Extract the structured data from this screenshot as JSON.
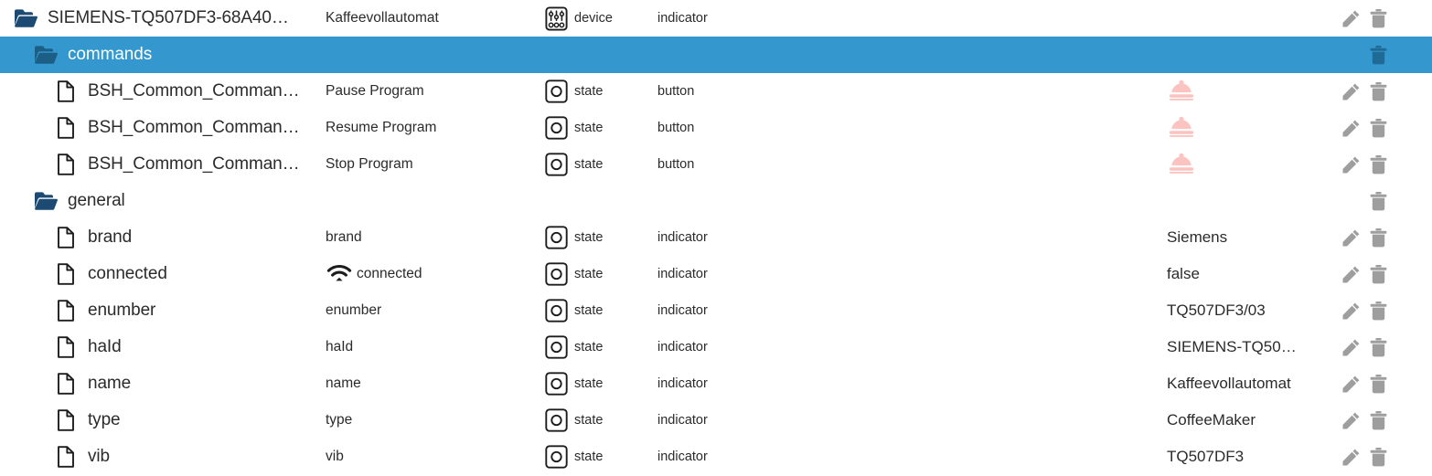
{
  "theme": {
    "selected_row_bg": "#3498cf",
    "folder_icon_color": "#1c4a73",
    "file_icon_color": "#1d1d1d",
    "action_icon_color": "#9e9e9e",
    "selected_action_icon_color": "#1f6b96",
    "alarm_icon_color": "#fbc4c0",
    "text_color": "#2b2b2b"
  },
  "icons": {
    "folder": "folder-icon",
    "file": "file-icon",
    "device": "device-sliders-icon",
    "state": "state-circle-icon",
    "wifi": "wifi-icon",
    "alarm": "bell-dome-icon",
    "edit": "pencil-icon",
    "delete": "trash-icon"
  },
  "rows": [
    {
      "id": "SIEMENS-TQ507DF3-68A40…",
      "common_name": "Kaffeevollautomat",
      "role_icon": "device",
      "role": "device",
      "kind": "indicator",
      "value": "",
      "type": "folder",
      "depth": 0,
      "selected": false,
      "wifi": false,
      "alarm": false,
      "edit": true,
      "delete": true
    },
    {
      "id": "commands",
      "common_name": "",
      "role_icon": "",
      "role": "",
      "kind": "",
      "value": "",
      "type": "folder",
      "depth": 1,
      "selected": true,
      "wifi": false,
      "alarm": false,
      "edit": false,
      "delete": true
    },
    {
      "id": "BSH_Common_Comman…",
      "common_name": "Pause Program",
      "role_icon": "state",
      "role": "state",
      "kind": "button",
      "value": "",
      "type": "file",
      "depth": 2,
      "selected": false,
      "wifi": false,
      "alarm": true,
      "edit": true,
      "delete": true
    },
    {
      "id": "BSH_Common_Comman…",
      "common_name": "Resume Program",
      "role_icon": "state",
      "role": "state",
      "kind": "button",
      "value": "",
      "type": "file",
      "depth": 2,
      "selected": false,
      "wifi": false,
      "alarm": true,
      "edit": true,
      "delete": true
    },
    {
      "id": "BSH_Common_Comman…",
      "common_name": "Stop Program",
      "role_icon": "state",
      "role": "state",
      "kind": "button",
      "value": "",
      "type": "file",
      "depth": 2,
      "selected": false,
      "wifi": false,
      "alarm": true,
      "edit": true,
      "delete": true
    },
    {
      "id": "general",
      "common_name": "",
      "role_icon": "",
      "role": "",
      "kind": "",
      "value": "",
      "type": "folder",
      "depth": 1,
      "selected": false,
      "wifi": false,
      "alarm": false,
      "edit": false,
      "delete": true
    },
    {
      "id": "brand",
      "common_name": "brand",
      "role_icon": "state",
      "role": "state",
      "kind": "indicator",
      "value": "Siemens",
      "type": "file",
      "depth": 2,
      "selected": false,
      "wifi": false,
      "alarm": false,
      "edit": true,
      "delete": true
    },
    {
      "id": "connected",
      "common_name": "connected",
      "role_icon": "state",
      "role": "state",
      "kind": "indicator",
      "value": "false",
      "type": "file",
      "depth": 2,
      "selected": false,
      "wifi": true,
      "alarm": false,
      "edit": true,
      "delete": true
    },
    {
      "id": "enumber",
      "common_name": "enumber",
      "role_icon": "state",
      "role": "state",
      "kind": "indicator",
      "value": "TQ507DF3/03",
      "type": "file",
      "depth": 2,
      "selected": false,
      "wifi": false,
      "alarm": false,
      "edit": true,
      "delete": true
    },
    {
      "id": "haId",
      "common_name": "haId",
      "role_icon": "state",
      "role": "state",
      "kind": "indicator",
      "value": "SIEMENS-TQ50…",
      "type": "file",
      "depth": 2,
      "selected": false,
      "wifi": false,
      "alarm": false,
      "edit": true,
      "delete": true
    },
    {
      "id": "name",
      "common_name": "name",
      "role_icon": "state",
      "role": "state",
      "kind": "indicator",
      "value": "Kaffeevollautomat",
      "type": "file",
      "depth": 2,
      "selected": false,
      "wifi": false,
      "alarm": false,
      "edit": true,
      "delete": true
    },
    {
      "id": "type",
      "common_name": "type",
      "role_icon": "state",
      "role": "state",
      "kind": "indicator",
      "value": "CoffeeMaker",
      "type": "file",
      "depth": 2,
      "selected": false,
      "wifi": false,
      "alarm": false,
      "edit": true,
      "delete": true
    },
    {
      "id": "vib",
      "common_name": "vib",
      "role_icon": "state",
      "role": "state",
      "kind": "indicator",
      "value": "TQ507DF3",
      "type": "file",
      "depth": 2,
      "selected": false,
      "wifi": false,
      "alarm": false,
      "edit": true,
      "delete": true
    }
  ]
}
